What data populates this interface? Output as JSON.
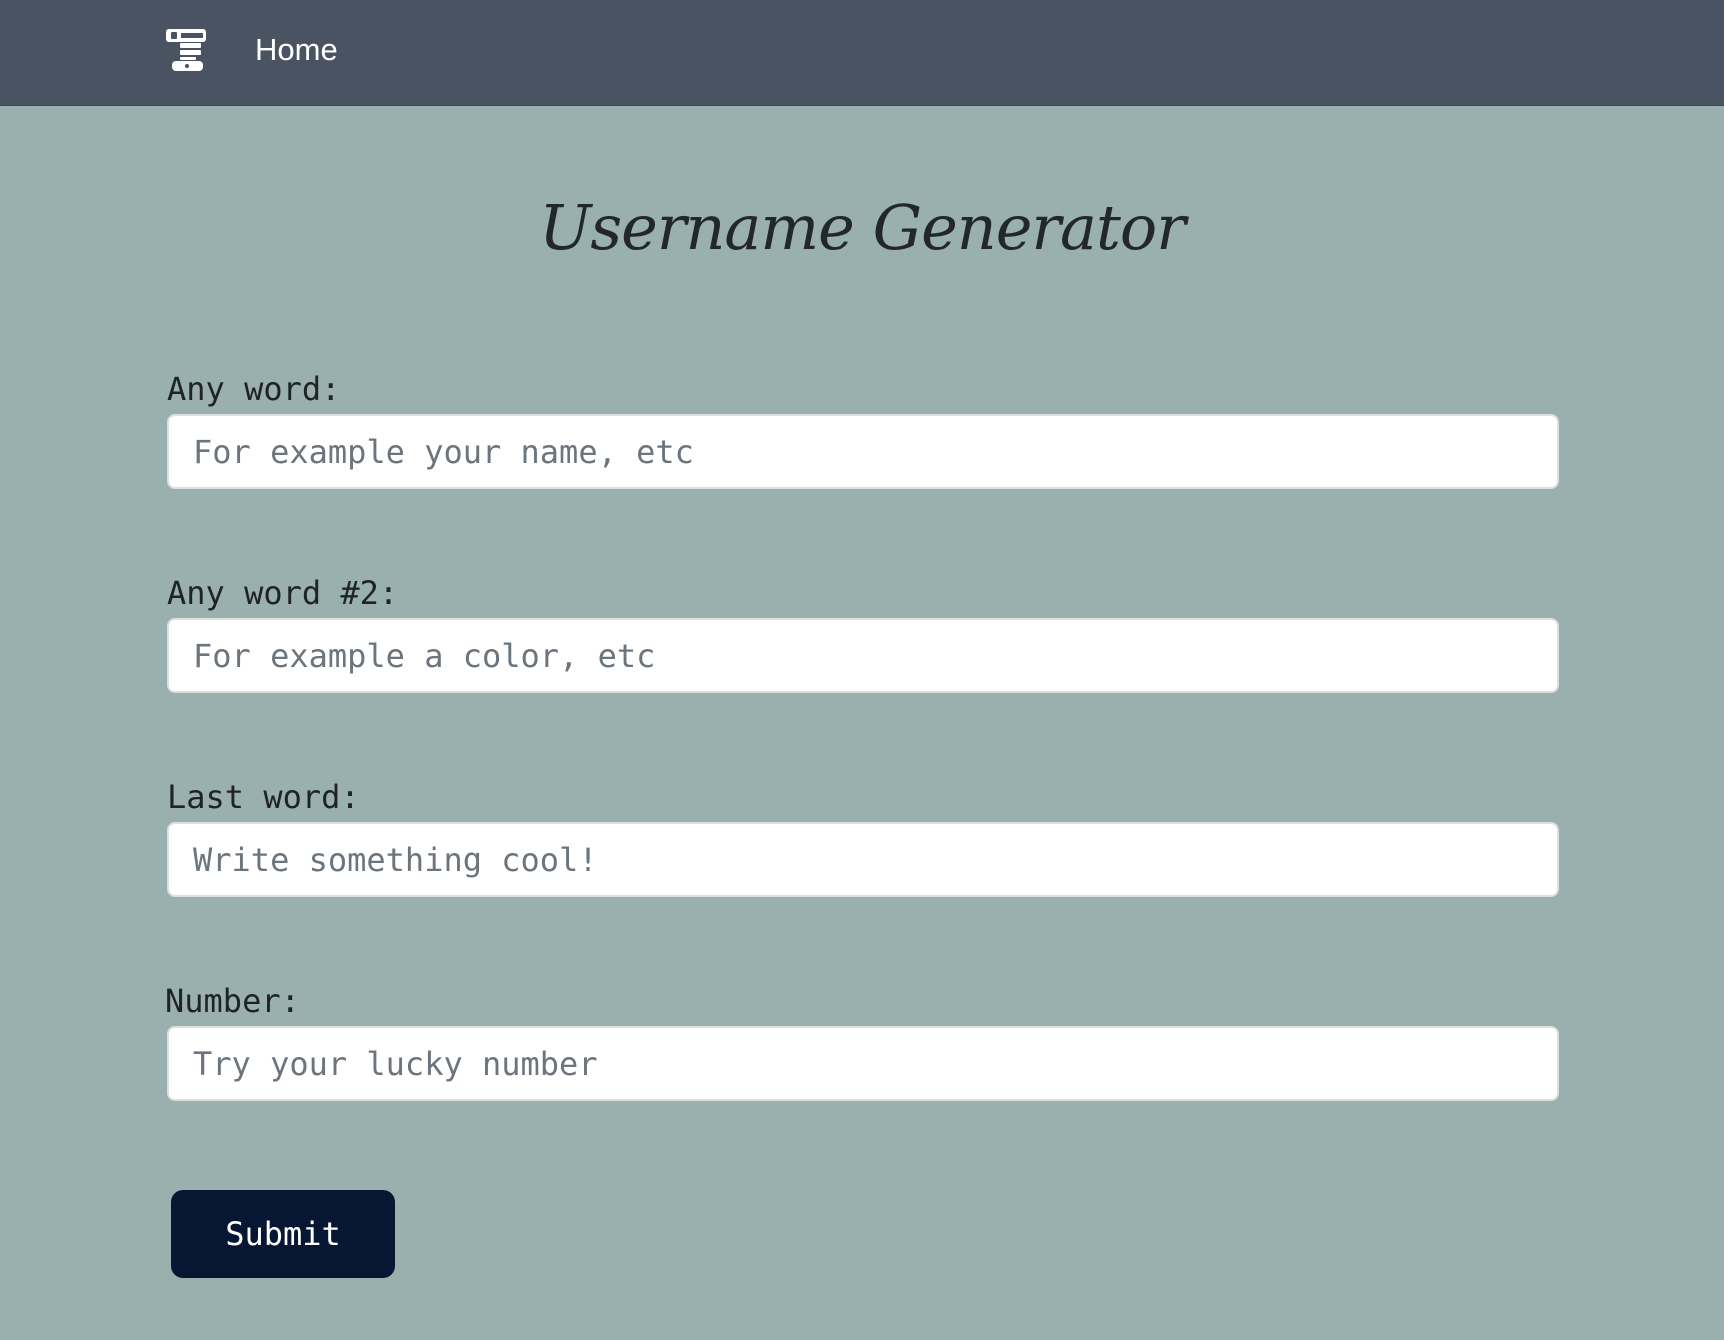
{
  "navbar": {
    "brand_icon": "stacked-bars-logo-icon",
    "home_label": "Home",
    "background": "#4a5362"
  },
  "page": {
    "title": "Username Generator",
    "background": "#9ab0ae"
  },
  "form": {
    "fields": [
      {
        "label": "Any word:",
        "placeholder": "For example your name, etc",
        "value": ""
      },
      {
        "label": "Any word #2:",
        "placeholder": "For example a color, etc",
        "value": ""
      },
      {
        "label": "Last word:",
        "placeholder": "Write something cool!",
        "value": ""
      },
      {
        "label": "Number:",
        "placeholder": "Try your lucky number",
        "value": ""
      }
    ],
    "submit_label": "Submit",
    "submit_color": "#071633"
  }
}
